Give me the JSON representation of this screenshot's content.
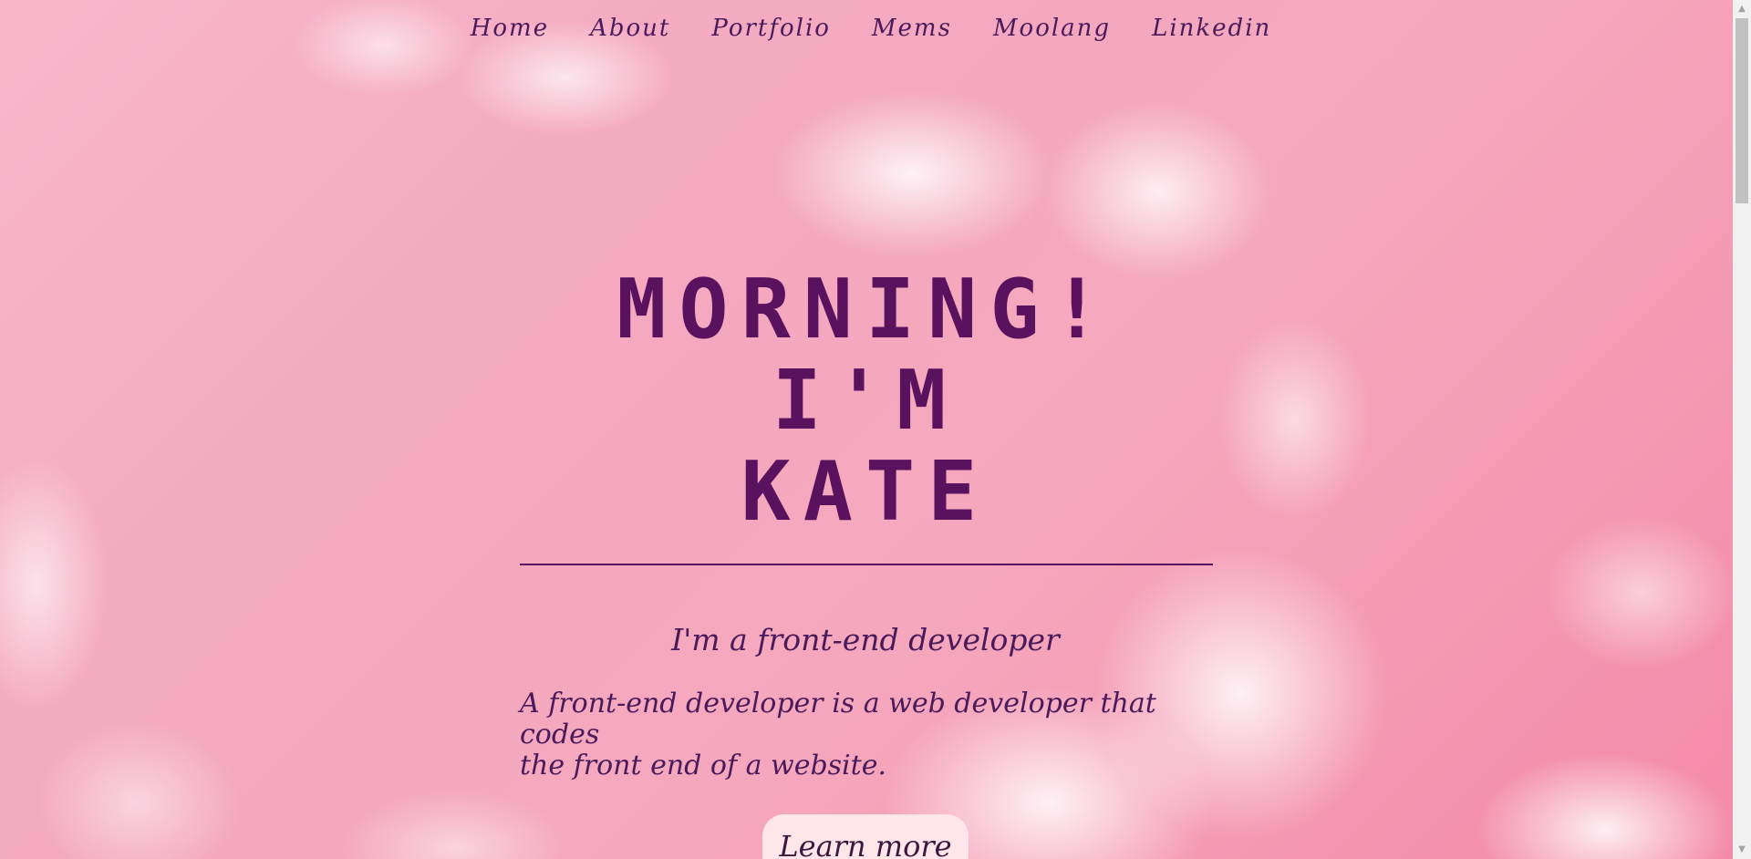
{
  "nav": {
    "items": [
      {
        "label": "Home"
      },
      {
        "label": "About"
      },
      {
        "label": "Portfolio"
      },
      {
        "label": "Mems"
      },
      {
        "label": "Moolang"
      },
      {
        "label": "Linkedin"
      }
    ]
  },
  "hero": {
    "title_line1": "MORNING! I'M",
    "title_line2": "KATE",
    "subtitle": "I'm a front-end developer",
    "description_line1": "A front-end developer is a web developer that codes",
    "description_line2": "the front end of a website.",
    "cta_label": "Learn more"
  },
  "scrollbar": {
    "up_arrow": "▲",
    "down_arrow": "▼"
  },
  "colors": {
    "text": "#4a1a5a",
    "title": "#5a125f",
    "button_bg": "#ffe6e9",
    "background": "#f5a7bd"
  }
}
